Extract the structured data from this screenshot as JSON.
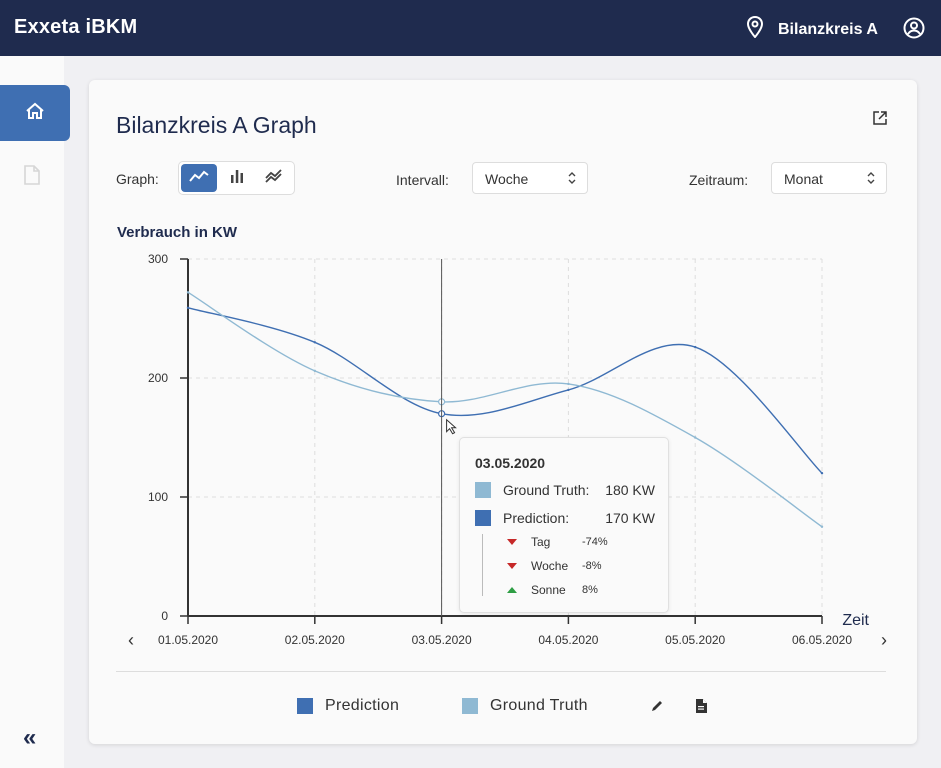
{
  "app": {
    "title": "Exxeta iBKM",
    "location": "Bilanzkreis A"
  },
  "icons": {
    "location": "location-pin-icon",
    "user": "user-circle-icon",
    "home": "home-icon",
    "document": "document-icon",
    "collapse": "double-chevron-left-icon",
    "external": "open-external-icon",
    "edit": "pencil-icon",
    "file": "file-icon"
  },
  "sidebar": {
    "collapse_label": "«"
  },
  "card": {
    "title": "Bilanzkreis A Graph",
    "controls": {
      "graph_label": "Graph:",
      "interval_label": "Intervall:",
      "interval_value": "Woche",
      "period_label": "Zeitraum:",
      "period_value": "Monat"
    }
  },
  "colors": {
    "prediction": "#3f6fb2",
    "ground_truth": "#8fb9d3",
    "header": "#1f2b4e"
  },
  "tooltip": {
    "date": "03.05.2020",
    "rows": [
      {
        "label": "Ground Truth:",
        "value": "180 KW"
      },
      {
        "label": "Prediction:",
        "value": "170 KW"
      }
    ],
    "changes": [
      {
        "label": "Tag",
        "value": "-74%",
        "direction": "down"
      },
      {
        "label": "Woche",
        "value": "-8%",
        "direction": "down"
      },
      {
        "label": "Sonne",
        "value": "8%",
        "direction": "up"
      }
    ]
  },
  "legend": {
    "prediction": "Prediction",
    "ground_truth": "Ground Truth"
  },
  "nav": {
    "prev": "‹",
    "next": "›"
  },
  "chart_data": {
    "type": "line",
    "ylabel": "Verbrauch in KW",
    "xlabel": "Zeit",
    "categories": [
      "01.05.2020",
      "02.05.2020",
      "03.05.2020",
      "04.05.2020",
      "05.05.2020",
      "06.05.2020"
    ],
    "y_ticks": [
      "300",
      "200",
      "100",
      "0"
    ],
    "ylim": [
      0,
      300
    ],
    "grid": true,
    "series": [
      {
        "name": "Prediction",
        "values": [
          259,
          230,
          170,
          190,
          226,
          120
        ]
      },
      {
        "name": "Ground Truth",
        "values": [
          272,
          206,
          180,
          195,
          150,
          75
        ]
      }
    ],
    "highlight_index": 2
  }
}
